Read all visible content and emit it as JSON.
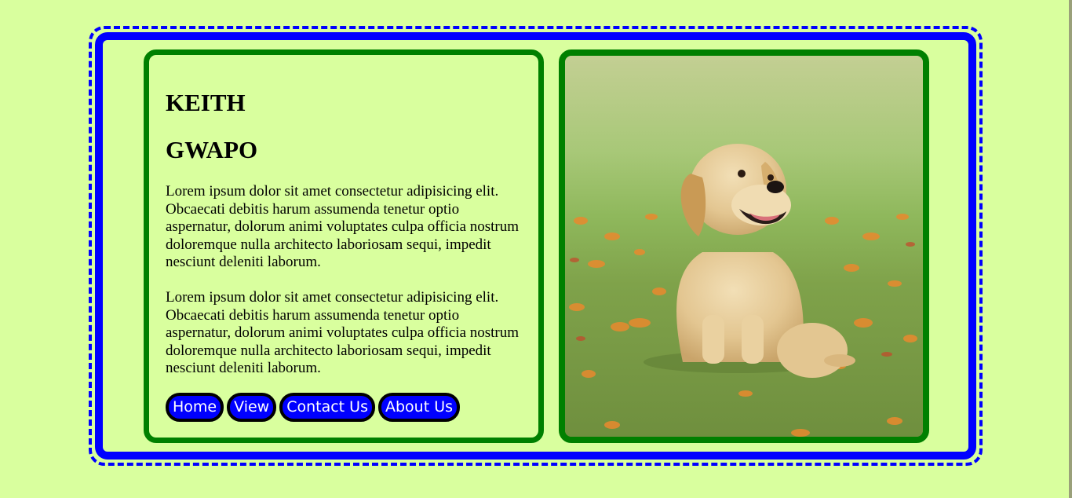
{
  "page": {
    "title_line_1": "KEITH",
    "title_line_2": "GWAPO",
    "paragraphs": [
      "Lorem ipsum dolor sit amet consectetur adipisicing elit. Obcaecati debitis harum assumenda tenetur optio aspernatur, dolorum animi voluptates culpa officia nostrum doloremque nulla architecto laboriosam sequi, impedit nesciunt deleniti laborum.",
      "Lorem ipsum dolor sit amet consectetur adipisicing elit. Obcaecati debitis harum assumenda tenetur optio aspernatur, dolorum animi voluptates culpa officia nostrum doloremque nulla architecto laboriosam sequi, impedit nesciunt deleniti laborum."
    ]
  },
  "nav": {
    "home_label": "Home",
    "view_label": "View",
    "contact_label": "Contact Us",
    "about_label": "About Us"
  },
  "photo": {
    "subject": "golden retriever puppy sitting in grass with orange flowers"
  },
  "colors": {
    "background": "#d9ff9e",
    "outer_border": "#0000ff",
    "card_border": "#008000",
    "button_bg": "#0000ff",
    "button_border": "#000000",
    "button_text": "#ffffff"
  }
}
